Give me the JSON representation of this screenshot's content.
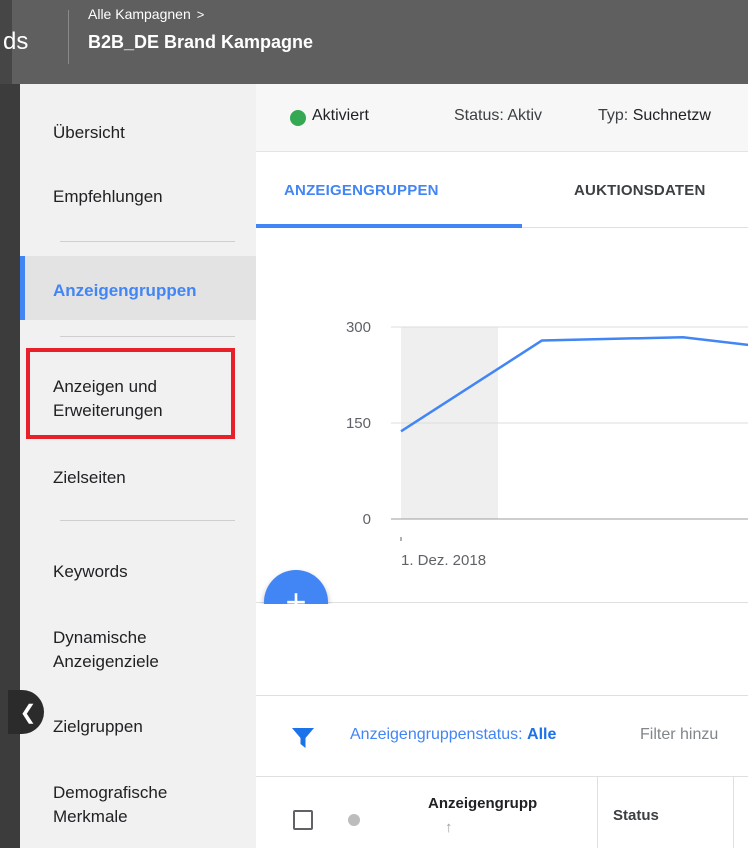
{
  "header": {
    "logo_fragment": "ds",
    "breadcrumb": "Alle Kampagnen",
    "breadcrumb_chevron": ">",
    "campaign_title": "B2B_DE Brand Kampagne"
  },
  "sidebar": {
    "items": [
      {
        "label": "Übersicht"
      },
      {
        "label": "Empfehlungen"
      },
      {
        "label": "Anzeigengruppen",
        "active": true
      },
      {
        "label": "Anzeigen und\nErweiterungen",
        "highlighted": true
      },
      {
        "label": "Zielseiten"
      },
      {
        "label": "Keywords"
      },
      {
        "label": "Dynamische\nAnzeigenziele"
      },
      {
        "label": "Zielgruppen"
      },
      {
        "label": "Demografische\nMerkmale"
      }
    ],
    "collapse_icon": "chevron-left-icon"
  },
  "status_bar": {
    "enabled_label": "Aktiviert",
    "status_label": "Status:",
    "status_value": "Aktiv",
    "type_label": "Typ:",
    "type_value": "Suchnetzw"
  },
  "tabs": [
    {
      "label": "ANZEIGENGRUPPEN",
      "active": true
    },
    {
      "label": "AUKTIONSDATEN"
    }
  ],
  "chart_data": {
    "type": "line",
    "y_ticks": [
      "300",
      "150",
      "0"
    ],
    "ylim": [
      0,
      300
    ],
    "x_label_first": "1. Dez. 2018",
    "x": [
      0,
      1,
      2,
      3
    ],
    "values": [
      137,
      279,
      284,
      258
    ],
    "line_color": "#4285f4",
    "shaded_band": "first day"
  },
  "fab": {
    "label": "+"
  },
  "filter": {
    "label": "Anzeigengruppenstatus:",
    "value": "Alle",
    "add_filter": "Filter hinzu"
  },
  "table": {
    "column_name": "Anzeigengrupp",
    "sort_icon": "↑",
    "column_status": "Status"
  },
  "colors": {
    "accent": "#4285f4",
    "active_dot": "#34a853",
    "highlight_box": "#e8202a"
  }
}
